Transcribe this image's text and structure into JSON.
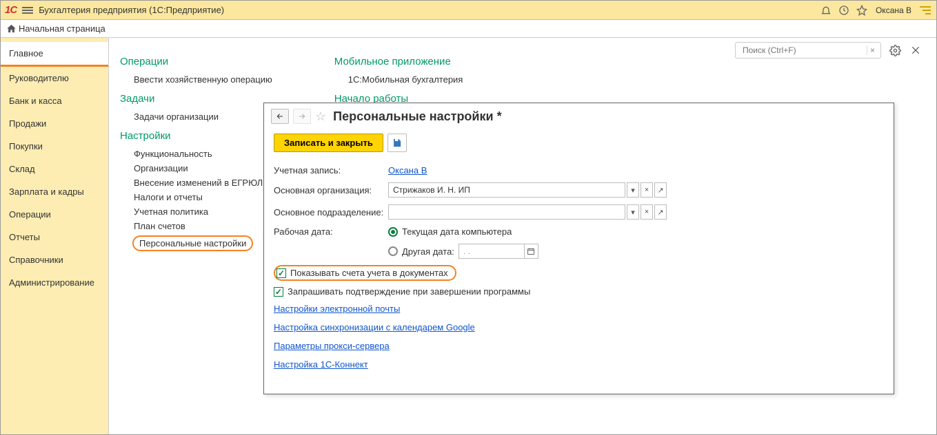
{
  "titlebar": {
    "app_title": "Бухгалтерия предприятия  (1С:Предприятие)",
    "user": "Оксана В"
  },
  "crumb": {
    "home_label": "Начальная страница"
  },
  "sidebar": {
    "items": [
      {
        "label": "Главное",
        "active": true
      },
      {
        "label": "Руководителю"
      },
      {
        "label": "Банк и касса"
      },
      {
        "label": "Продажи"
      },
      {
        "label": "Покупки"
      },
      {
        "label": "Склад"
      },
      {
        "label": "Зарплата и кадры"
      },
      {
        "label": "Операции"
      },
      {
        "label": "Отчеты"
      },
      {
        "label": "Справочники"
      },
      {
        "label": "Администрирование"
      }
    ]
  },
  "search": {
    "placeholder": "Поиск (Ctrl+F)",
    "clear": "×"
  },
  "content": {
    "col1": {
      "s1": {
        "title": "Операции",
        "items": [
          "Ввести хозяйственную операцию"
        ]
      },
      "s2": {
        "title": "Задачи",
        "items": [
          "Задачи организации"
        ]
      },
      "s3": {
        "title": "Настройки",
        "items": [
          "Функциональность",
          "Организации",
          "Внесение изменений в ЕГРЮЛ",
          "Налоги и отчеты",
          "Учетная политика",
          "План счетов",
          "Персональные настройки"
        ]
      }
    },
    "col2": {
      "s1": {
        "title": "Мобильное приложение",
        "items": [
          "1С:Мобильная бухгалтерия"
        ]
      },
      "s2": {
        "title": "Начало работы"
      }
    }
  },
  "modal": {
    "title": "Персональные настройки *",
    "save_close": "Записать и закрыть",
    "rows": {
      "account_label": "Учетная запись:",
      "account_value": "Оксана В",
      "org_label": "Основная организация:",
      "org_value": "Стрижаков И. Н. ИП",
      "dept_label": "Основное подразделение:",
      "dept_value": "",
      "workdate_label": "Рабочая дата:",
      "radio1": "Текущая дата компьютера",
      "radio2": "Другая дата:",
      "dateplaceholder": "  .  .",
      "check1": "Показывать счета учета в документах",
      "check2": "Запрашивать подтверждение при завершении программы"
    },
    "links": [
      "Настройки электронной почты",
      "Настройка синхронизации с календарем Google",
      "Параметры прокси-сервера",
      "Настройка 1С-Коннект"
    ]
  }
}
